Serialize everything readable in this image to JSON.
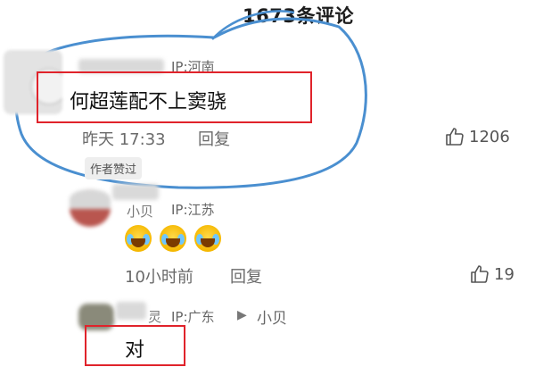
{
  "header": {
    "comment_count": "1673条评论"
  },
  "comments": [
    {
      "ip": "IP:河南",
      "text": "何超莲配不上窦骁",
      "time": "昨天 17:33",
      "reply_label": "回复",
      "likes": "1206",
      "badge": "作者赞过"
    },
    {
      "username_fragment": "小贝",
      "ip": "IP:江苏",
      "time": "10小时前",
      "reply_label": "回复",
      "likes": "19",
      "emoji_count": 3
    },
    {
      "username_fragment": "灵",
      "ip": "IP:广东",
      "reply_to": "小贝",
      "text": "对"
    }
  ],
  "colors": {
    "highlight_box": "#e0232b",
    "annotation_circle": "#4a8fd0"
  },
  "icons": {
    "like": "thumbs-up-icon",
    "reply_arrow": "play-arrow-icon"
  }
}
